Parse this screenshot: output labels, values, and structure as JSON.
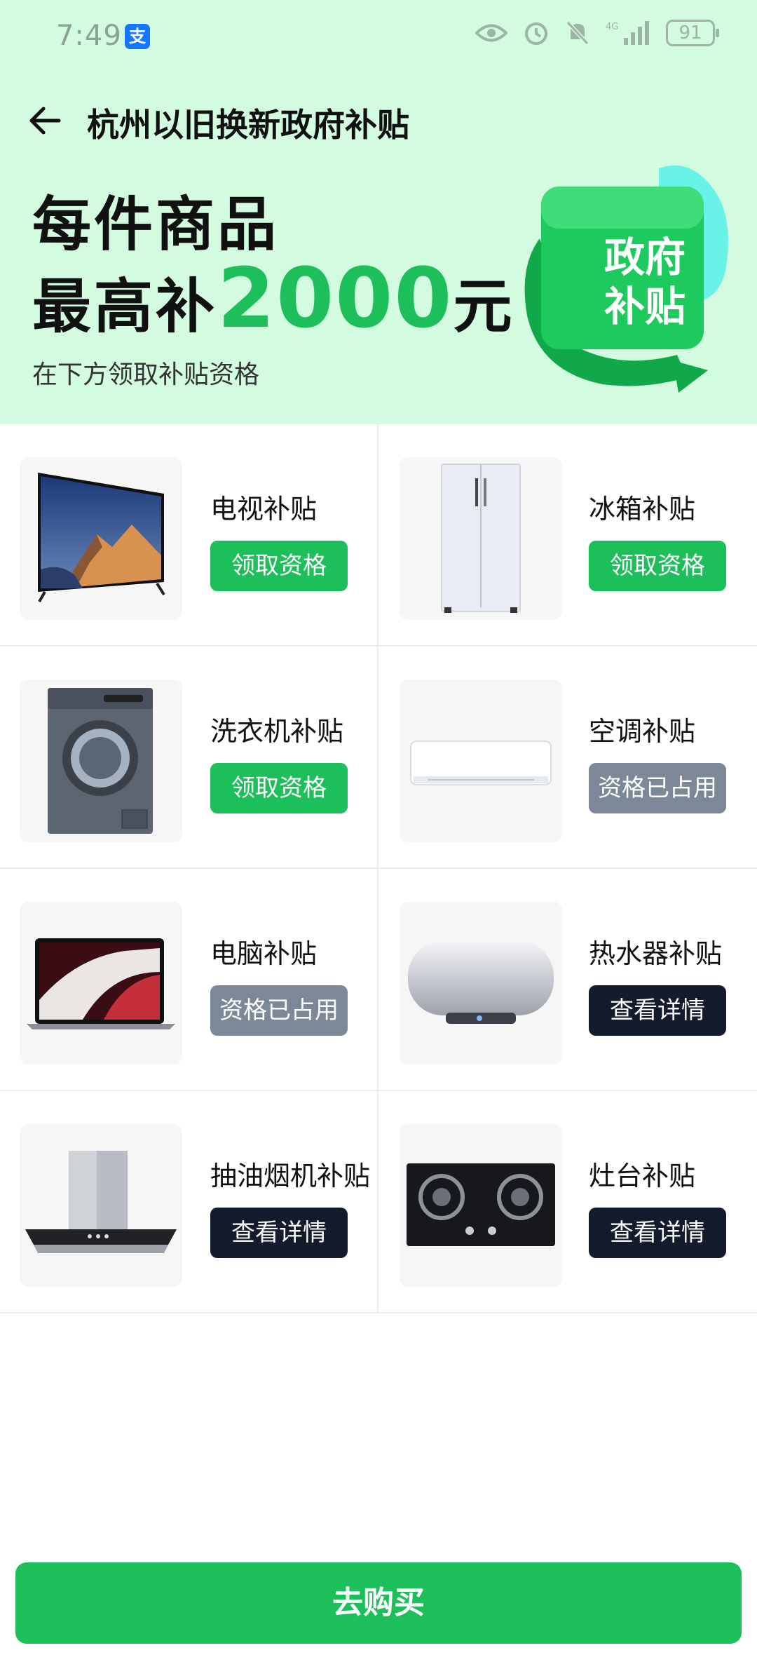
{
  "status_bar": {
    "time": "7:49",
    "alipay_badge": "支",
    "network": "4G",
    "battery": "91"
  },
  "nav": {
    "title": "杭州以旧换新政府补贴"
  },
  "promo": {
    "line1": "每件商品",
    "line2_prefix": "最高补",
    "amount": "2000",
    "unit": "元",
    "subtitle": "在下方领取补贴资格",
    "badge_line1": "政府",
    "badge_line2": "补贴"
  },
  "items": [
    {
      "title": "电视补贴",
      "button": "领取资格"
    },
    {
      "title": "冰箱补贴",
      "button": "领取资格"
    },
    {
      "title": "洗衣机补贴",
      "button": "领取资格"
    },
    {
      "title": "空调补贴",
      "button": "资格已占用"
    },
    {
      "title": "电脑补贴",
      "button": "资格已占用"
    },
    {
      "title": "热水器补贴",
      "button": "查看详情"
    },
    {
      "title": "抽油烟机补贴",
      "button": "查看详情"
    },
    {
      "title": "灶台补贴",
      "button": "查看详情"
    }
  ],
  "footer": {
    "buy_button": "去购买"
  },
  "colors": {
    "brand_green": "#1dbf5a",
    "hero_bg": "#d3fbe0",
    "occupied_gray": "#7c8797",
    "details_dark": "#141b2d"
  }
}
